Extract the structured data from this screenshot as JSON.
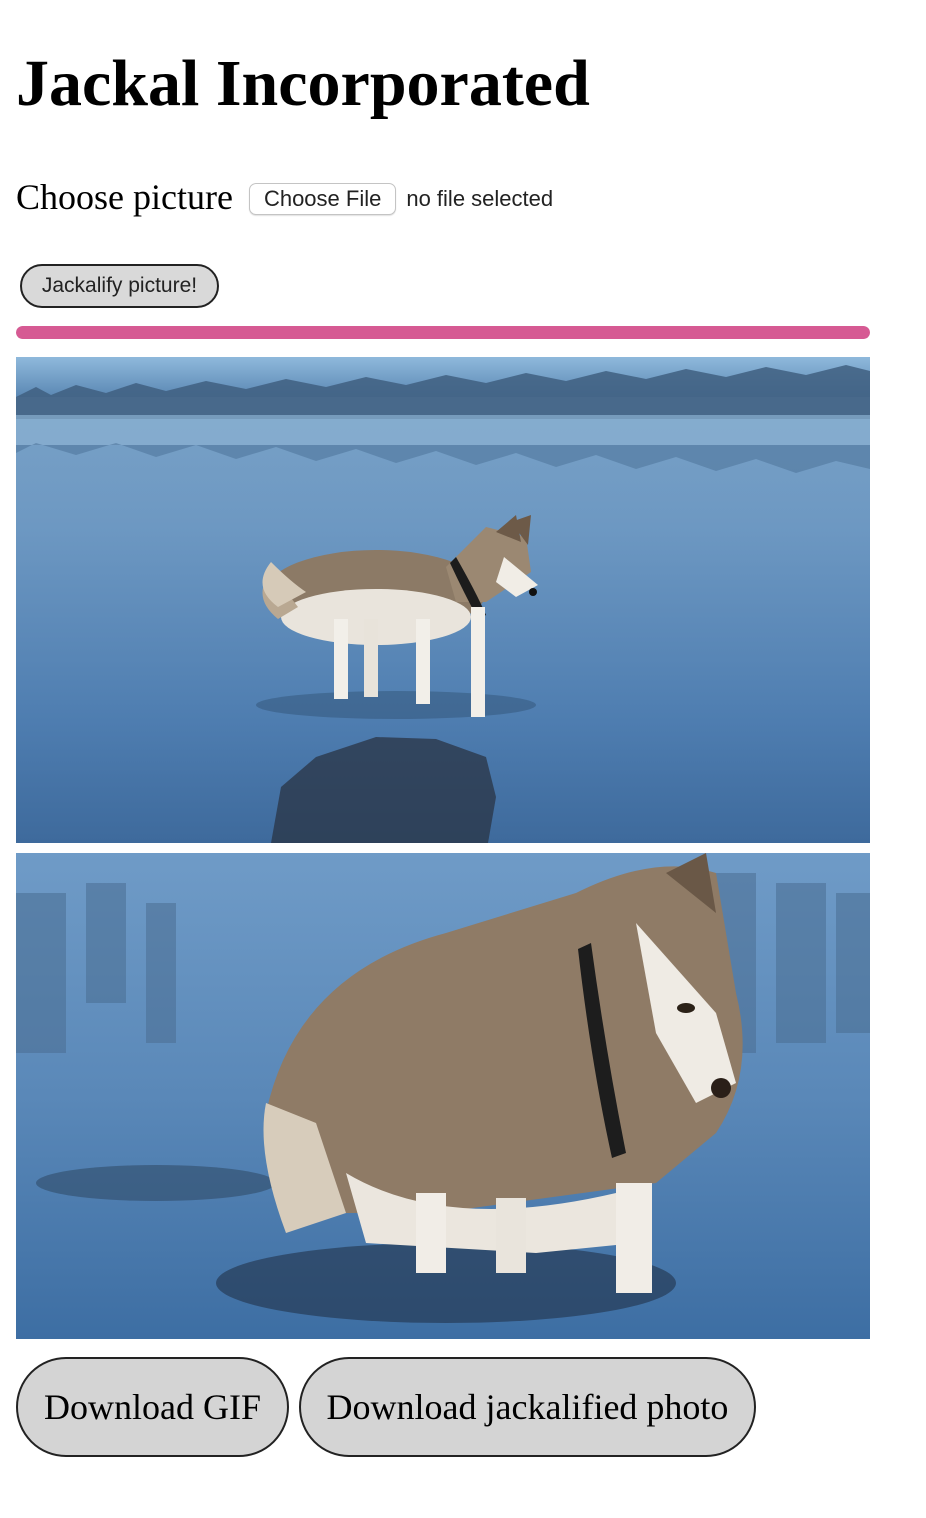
{
  "page": {
    "title": "Jackal Incorporated"
  },
  "upload": {
    "label": "Choose picture",
    "button_label": "Choose File",
    "status": "no file selected"
  },
  "actions": {
    "jackalify_label": "Jackalify picture!",
    "download_gif_label": "Download GIF",
    "download_photo_label": "Download jackalified photo"
  },
  "progress": {
    "value": 1.0,
    "color": "#d65a93"
  },
  "images": {
    "original_subject": "husky-on-water-icon",
    "jackalified_subject": "stretched-husky-icon"
  }
}
